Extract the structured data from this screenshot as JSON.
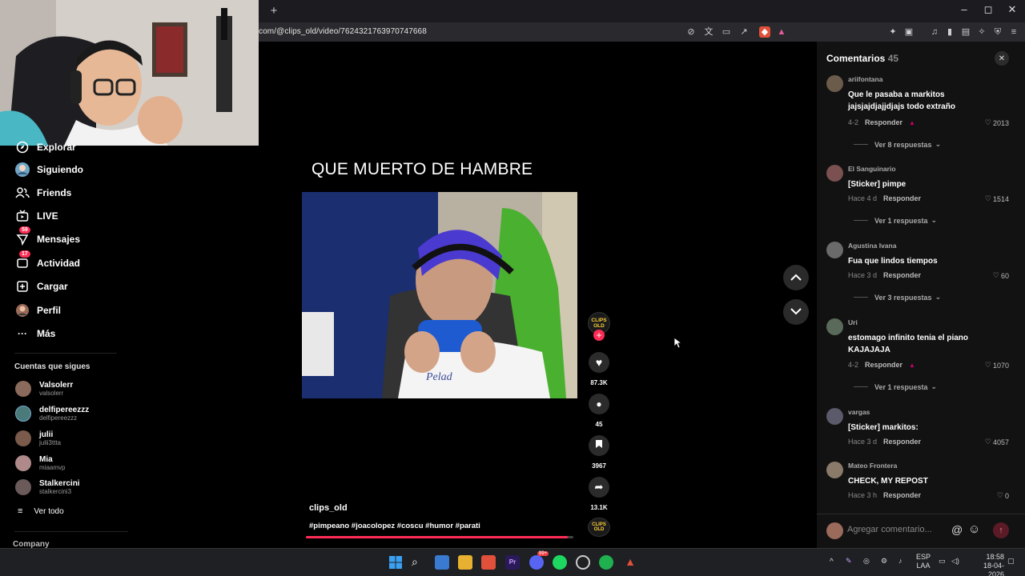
{
  "browser": {
    "url": "com/@clips_old/video/7624321763970747668",
    "new_tab_label": "+",
    "window_controls": {
      "minimize": "–",
      "maximize": "◻",
      "close": "✕"
    }
  },
  "sidebar": {
    "items": [
      {
        "label": "Explorar",
        "icon": "compass-icon"
      },
      {
        "label": "Siguiendo",
        "icon": "following-avatar-icon"
      },
      {
        "label": "Friends",
        "icon": "friends-icon"
      },
      {
        "label": "LIVE",
        "icon": "live-tv-icon"
      },
      {
        "label": "Mensajes",
        "icon": "message-icon",
        "badge": "59"
      },
      {
        "label": "Actividad",
        "icon": "activity-icon",
        "badge": "17"
      },
      {
        "label": "Cargar",
        "icon": "upload-icon"
      },
      {
        "label": "Perfil",
        "icon": "profile-avatar-icon"
      },
      {
        "label": "Más",
        "icon": "more-dots-icon"
      }
    ],
    "following_title": "Cuentas que sigues",
    "accounts": [
      {
        "name": "Valsolerr",
        "handle": "valsolerr",
        "color": "#8a6a5a"
      },
      {
        "name": "delfipereezzz",
        "handle": "delfipereezzz",
        "color": "#4a7a7a"
      },
      {
        "name": "julii",
        "handle": "julii3ttta",
        "color": "#7a5a4a"
      },
      {
        "name": "Mia",
        "handle": "miaamvp",
        "color": "#b08a8a"
      },
      {
        "name": "Stalkercini",
        "handle": "stalkercini3",
        "color": "#6a5a5a"
      }
    ],
    "see_all": "Ver todo",
    "company": "Company"
  },
  "video": {
    "title": "QUE MUERTO DE HAMBRE",
    "creator": "clips_old",
    "hashtags": "#pimpeano #joacolopez #coscu #humor #parati",
    "progress": 0.98,
    "likes": "87.3K",
    "comments": "45",
    "saves": "3967",
    "shares": "13.1K",
    "logo_text_top": "CLIPS",
    "logo_text_bottom": "OLD"
  },
  "comments_panel": {
    "title": "Comentarios",
    "count": "45",
    "input_placeholder": "Agregar comentario...",
    "reply_label": "Responder",
    "comments": [
      {
        "user": "ariifontana",
        "text": "Que le pasaba a markitos jajsjajdjajjdjajs todo extraño",
        "time": "4-2",
        "likes": "2013",
        "more": "Ver 8 respuestas",
        "avatar_color": "#6b5b4a"
      },
      {
        "user": "El Sanguinario",
        "text": "[Sticker] pimpe",
        "time": "Hace 4 d",
        "likes": "1514",
        "more": "Ver 1 respuesta",
        "avatar_color": "#7a5050"
      },
      {
        "user": "Agustina Ivana",
        "text": "Fua que lindos tiempos",
        "time": "Hace 3 d",
        "likes": "60",
        "more": "Ver 3 respuestas",
        "avatar_color": "#6a6a6a"
      },
      {
        "user": "Uri",
        "text": "estomago infinito tenia el piano KAJAJAJA",
        "time": "4-2",
        "likes": "1070",
        "more": "Ver 1 respuesta",
        "avatar_color": "#5a6a5a"
      },
      {
        "user": "vargas",
        "text": "[Sticker] markitos:",
        "time": "Hace 3 d",
        "likes": "4057",
        "more": "",
        "avatar_color": "#5a5a6a"
      },
      {
        "user": "Mateo Frontera",
        "text": "CHECK, MY REPOST",
        "time": "Hace 3 h",
        "likes": "0",
        "more": "",
        "avatar_color": "#8a7a6a"
      }
    ]
  },
  "taskbar": {
    "language": "ESP",
    "layout": "LAA",
    "time": "18:58",
    "date": "18-04-2026",
    "discord_badge": "99+"
  },
  "colors": {
    "accent": "#fe2c55",
    "panel_bg": "#121212",
    "page_bg": "#000000"
  }
}
